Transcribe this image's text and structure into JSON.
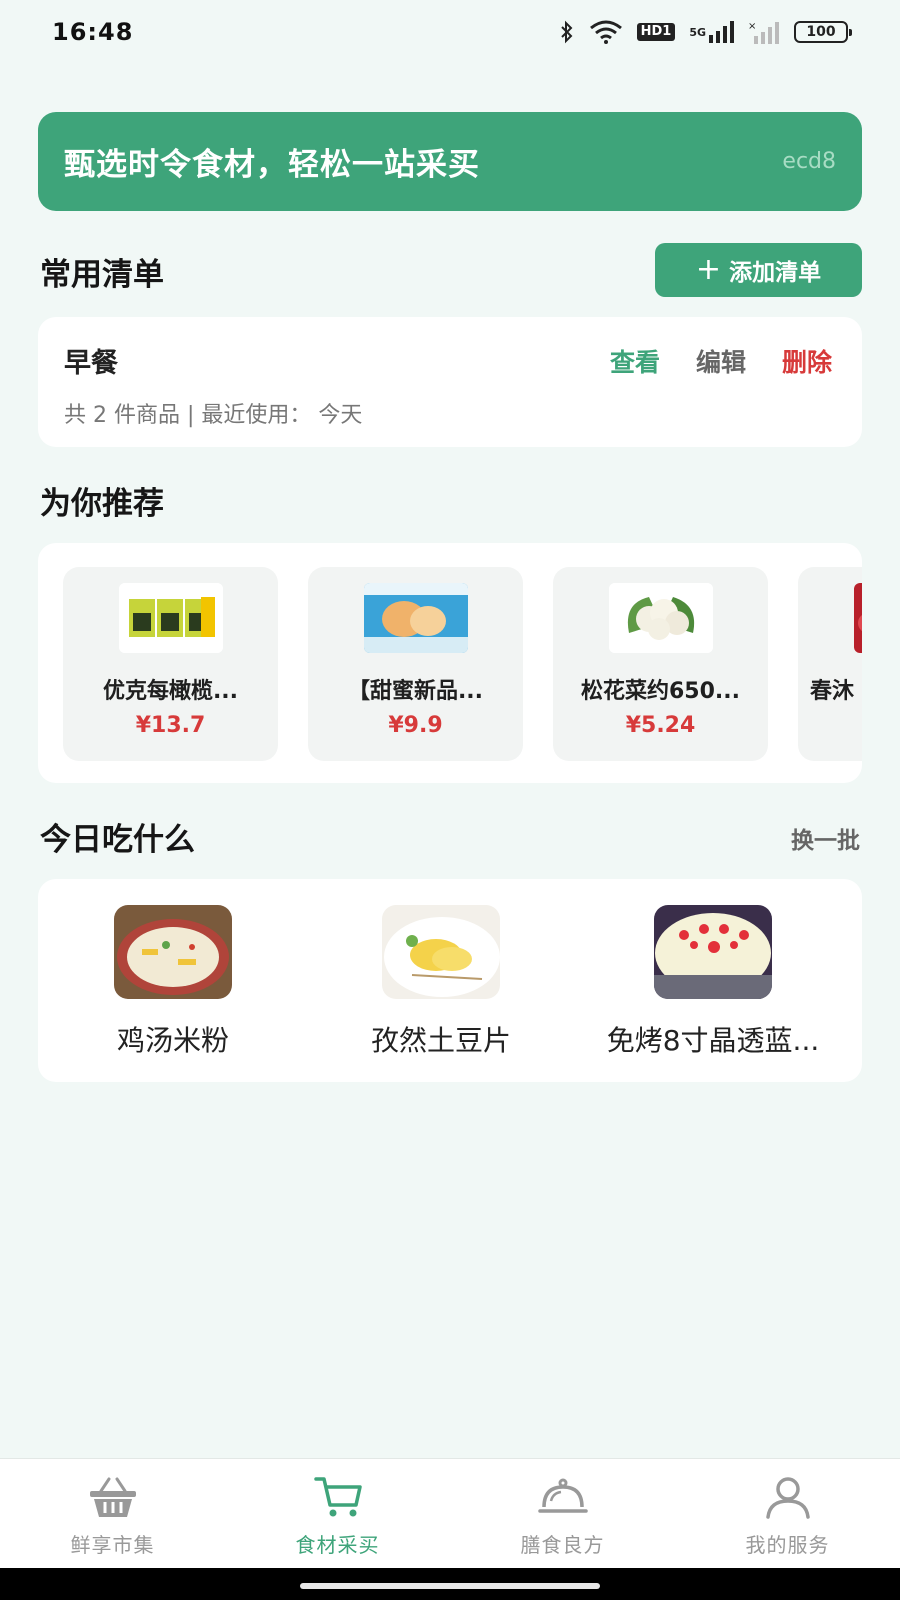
{
  "status_bar": {
    "time": "16:48",
    "hd": "HD1",
    "network": "5G",
    "battery": "100"
  },
  "banner": {
    "text": "甄选时令食材，轻松一站采买",
    "tag": "ecd8"
  },
  "frequent_lists": {
    "title": "常用清单",
    "add_button": "添加清单",
    "items": [
      {
        "name": "早餐",
        "meta": "共 2 件商品 | 最近使用： 今天",
        "view": "查看",
        "edit": "编辑",
        "delete": "删除"
      }
    ]
  },
  "recommend": {
    "title": "为你推荐",
    "items": [
      {
        "name": "优克每橄榄...",
        "price": "¥13.7"
      },
      {
        "name": "【甜蜜新品...",
        "price": "¥9.9"
      },
      {
        "name": "松花菜约650...",
        "price": "¥5.24"
      },
      {
        "name": "春沐",
        "price": ""
      }
    ]
  },
  "today": {
    "title": "今日吃什么",
    "refresh": "换一批",
    "dishes": [
      {
        "name": "鸡汤米粉"
      },
      {
        "name": "孜然土豆片"
      },
      {
        "name": "免烤8寸晶透蓝..."
      }
    ]
  },
  "bottom_nav": {
    "items": [
      {
        "label": "鲜享市集",
        "icon": "basket-icon"
      },
      {
        "label": "食材采买",
        "icon": "cart-icon"
      },
      {
        "label": "膳食良方",
        "icon": "cloche-icon"
      },
      {
        "label": "我的服务",
        "icon": "user-icon"
      }
    ],
    "active_index": 1
  },
  "colors": {
    "accent": "#3ea47a",
    "danger": "#d73a3a",
    "background": "#f1f8f6"
  }
}
